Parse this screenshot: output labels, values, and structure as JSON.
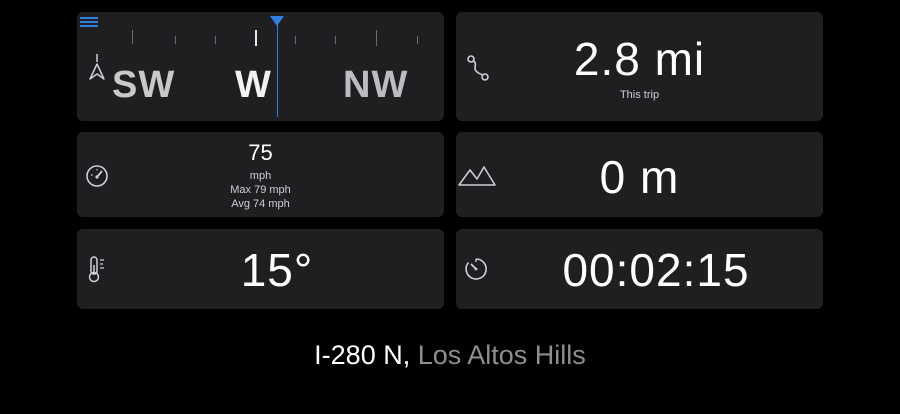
{
  "compass": {
    "headings": {
      "left": "SW",
      "center": "W",
      "right": "NW"
    }
  },
  "distance": {
    "value": "2.8 mi",
    "caption": "This trip"
  },
  "speed": {
    "value": "75",
    "unit": "mph",
    "max": "Max 79 mph",
    "avg": "Avg 74 mph"
  },
  "altitude": {
    "value": "0 m"
  },
  "temperature": {
    "value": "15°"
  },
  "timer": {
    "value": "00:02:15"
  },
  "location": {
    "road": "I-280 N",
    "separator": ", ",
    "place": "Los Altos Hills"
  },
  "colors": {
    "accent": "#2f7fe0",
    "card": "#1f1f21",
    "muted": "#8e8e93"
  },
  "icons": [
    "menu-icon",
    "navigation-arrow-icon",
    "route-icon",
    "speedometer-icon",
    "mountains-icon",
    "thermometer-icon",
    "timer-icon"
  ]
}
